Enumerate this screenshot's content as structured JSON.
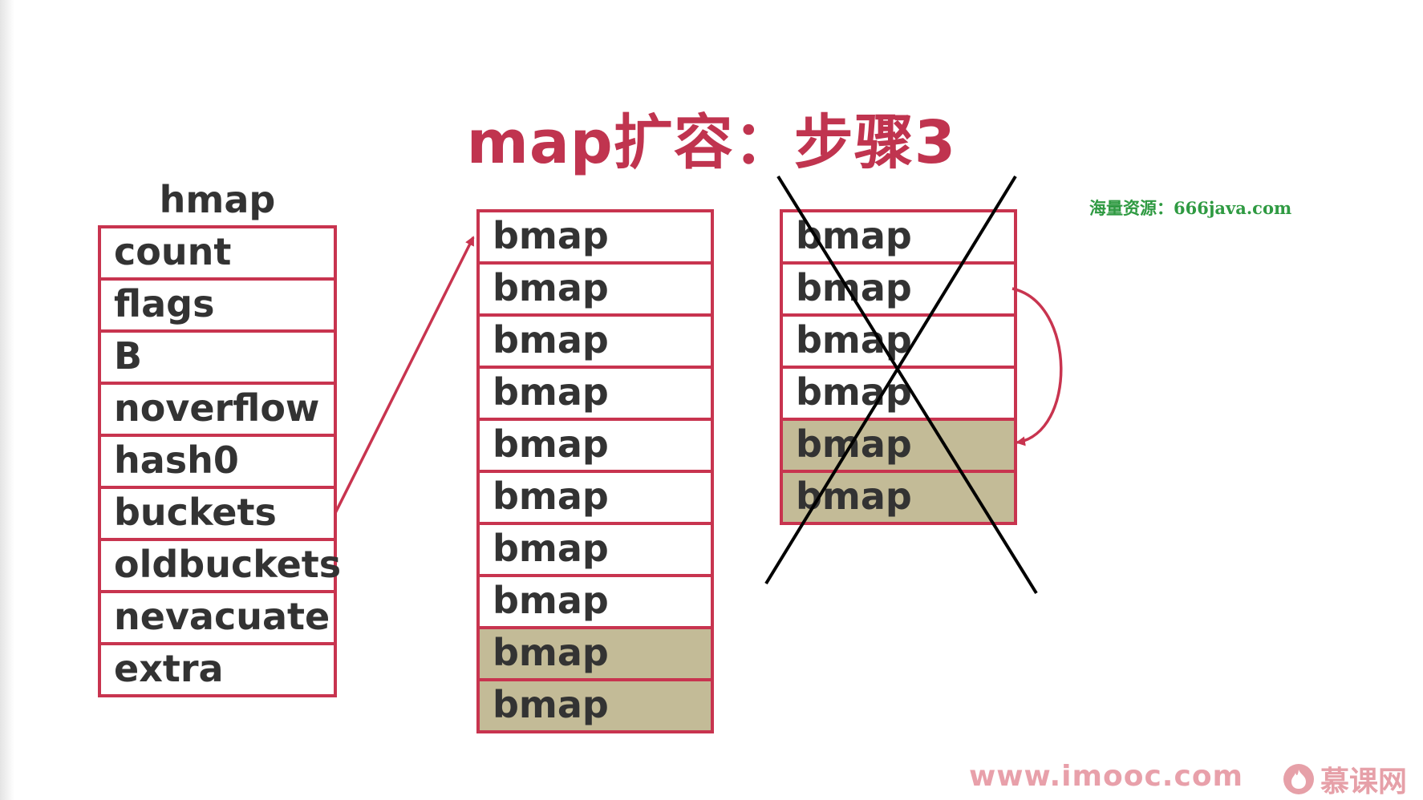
{
  "title": "map扩容：步骤3",
  "hmap": {
    "label": "hmap",
    "fields": [
      "count",
      "flags",
      "B",
      "noverflow",
      "hash0",
      "buckets",
      "oldbuckets",
      "nevacuate",
      "extra"
    ]
  },
  "new_buckets": {
    "cells": [
      {
        "label": "bmap",
        "highlight": false
      },
      {
        "label": "bmap",
        "highlight": false
      },
      {
        "label": "bmap",
        "highlight": false
      },
      {
        "label": "bmap",
        "highlight": false
      },
      {
        "label": "bmap",
        "highlight": false
      },
      {
        "label": "bmap",
        "highlight": false
      },
      {
        "label": "bmap",
        "highlight": false
      },
      {
        "label": "bmap",
        "highlight": false
      },
      {
        "label": "bmap",
        "highlight": true
      },
      {
        "label": "bmap",
        "highlight": true
      }
    ]
  },
  "old_buckets": {
    "cells": [
      {
        "label": "bmap",
        "highlight": false
      },
      {
        "label": "bmap",
        "highlight": false
      },
      {
        "label": "bmap",
        "highlight": false
      },
      {
        "label": "bmap",
        "highlight": false
      },
      {
        "label": "bmap",
        "highlight": true
      },
      {
        "label": "bmap",
        "highlight": true
      }
    ],
    "crossed_out": true
  },
  "watermark": "海量资源：666java.com",
  "footer": {
    "url": "www.imooc.com",
    "brand": "慕课网",
    "logo_icon": "flame-icon"
  },
  "colors": {
    "accent": "#c0344f",
    "border": "#c8344f",
    "highlight_fill": "#c3bb97",
    "text": "#333333",
    "watermark": "#2f9a42"
  }
}
